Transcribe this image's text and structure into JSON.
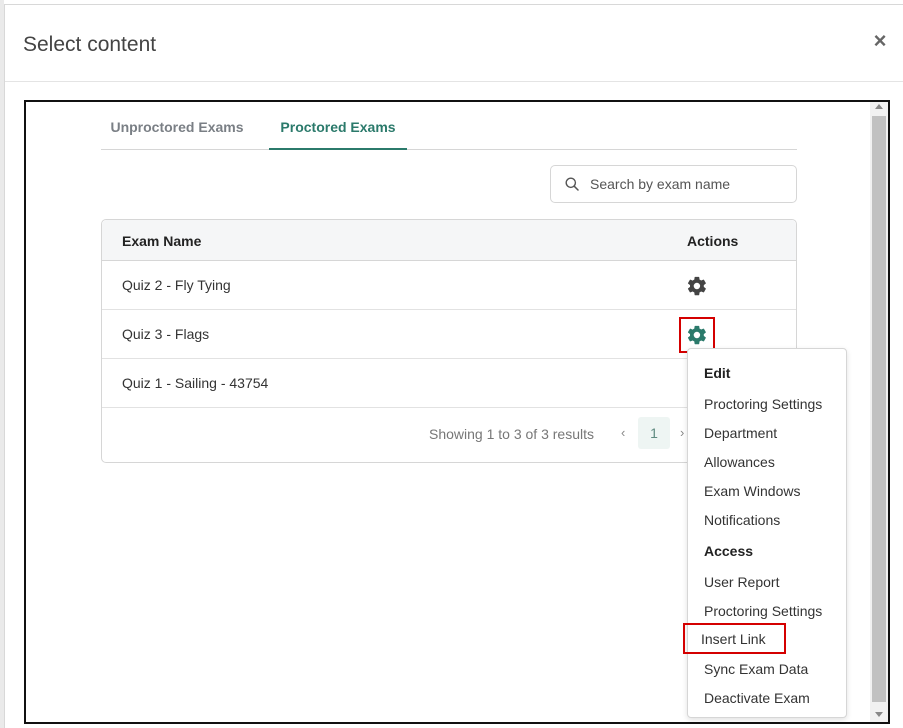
{
  "modal": {
    "title": "Select content",
    "close_label": "×"
  },
  "tabs": [
    {
      "label": "Unproctored Exams",
      "active": false
    },
    {
      "label": "Proctored Exams",
      "active": true
    }
  ],
  "search": {
    "placeholder": "Search by exam name",
    "value": ""
  },
  "table": {
    "headers": {
      "name": "Exam Name",
      "actions": "Actions"
    },
    "rows": [
      {
        "name": "Quiz 2 - Fly Tying"
      },
      {
        "name": "Quiz 3 - Flags"
      },
      {
        "name": "Quiz 1 - Sailing - 43754"
      }
    ],
    "footer": "Showing 1 to 3 of 3 results",
    "pagination": {
      "prev": "‹",
      "current": "1",
      "next": "›"
    }
  },
  "actions_menu": {
    "edit_header": "Edit",
    "edit_items": [
      "Proctoring Settings",
      "Department",
      "Allowances",
      "Exam Windows",
      "Notifications"
    ],
    "access_header": "Access",
    "access_items": [
      "User Report",
      "Proctoring Settings",
      "Insert Link",
      "Sync Exam Data",
      "Deactivate Exam"
    ]
  },
  "colors": {
    "accent": "#2b7a6b",
    "highlight": "#d40000",
    "gear_default": "#444444"
  },
  "icons": {
    "search": "search-icon",
    "gear": "gear-icon",
    "close": "close-icon"
  }
}
